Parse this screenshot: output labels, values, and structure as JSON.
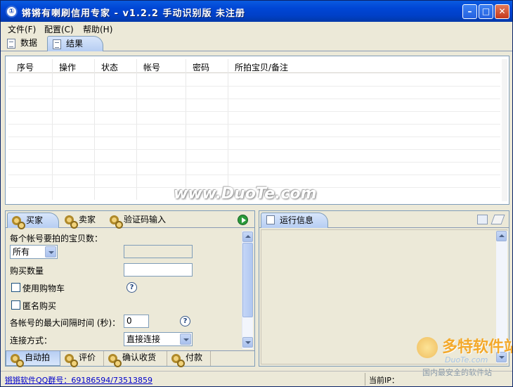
{
  "window": {
    "title": "锵锵有喇刷信用专家 - v1.2.2 手动识别版 未注册"
  },
  "menu": [
    {
      "label": "文件(F)"
    },
    {
      "label": "配置(C)"
    },
    {
      "label": "帮助(H)"
    }
  ],
  "top_tabs": [
    {
      "label": "数据",
      "active": false
    },
    {
      "label": "结果",
      "active": true
    }
  ],
  "results_table": {
    "columns": [
      "序号",
      "操作",
      "状态",
      "帐号",
      "密码",
      "所拍宝贝/备注"
    ],
    "rows": []
  },
  "watermark": "www.DuoTe.com",
  "left_panel": {
    "tabs": [
      {
        "label": "买家",
        "active": true
      },
      {
        "label": "卖家",
        "active": false
      },
      {
        "label": "验证码输入",
        "active": false
      }
    ],
    "form": {
      "items_per_account_label": "每个帐号要拍的宝贝数：",
      "items_select_value": "所有",
      "buy_qty_label": "购买数量",
      "buy_qty_value": "",
      "use_cart_label": "使用购物车",
      "anonymous_label": "匿名购买",
      "interval_label": "各帐号的最大间隔时间 (秒)：",
      "interval_value": "0",
      "connect_label": "连接方式：",
      "connect_value": "直接连接"
    },
    "bottom_tabs": [
      {
        "label": "自动拍",
        "active": true
      },
      {
        "label": "评价",
        "active": false
      },
      {
        "label": "确认收货",
        "active": false
      },
      {
        "label": "付款",
        "active": false
      }
    ]
  },
  "right_panel": {
    "title": "运行信息"
  },
  "status": {
    "qq_group": "锵锵软件QQ群号：69186594/73513859",
    "current_ip_label": "当前IP："
  },
  "brand": {
    "name": "多特软件站",
    "sub": "DuoTe.com",
    "tagline": "国内最安全的软件站"
  }
}
